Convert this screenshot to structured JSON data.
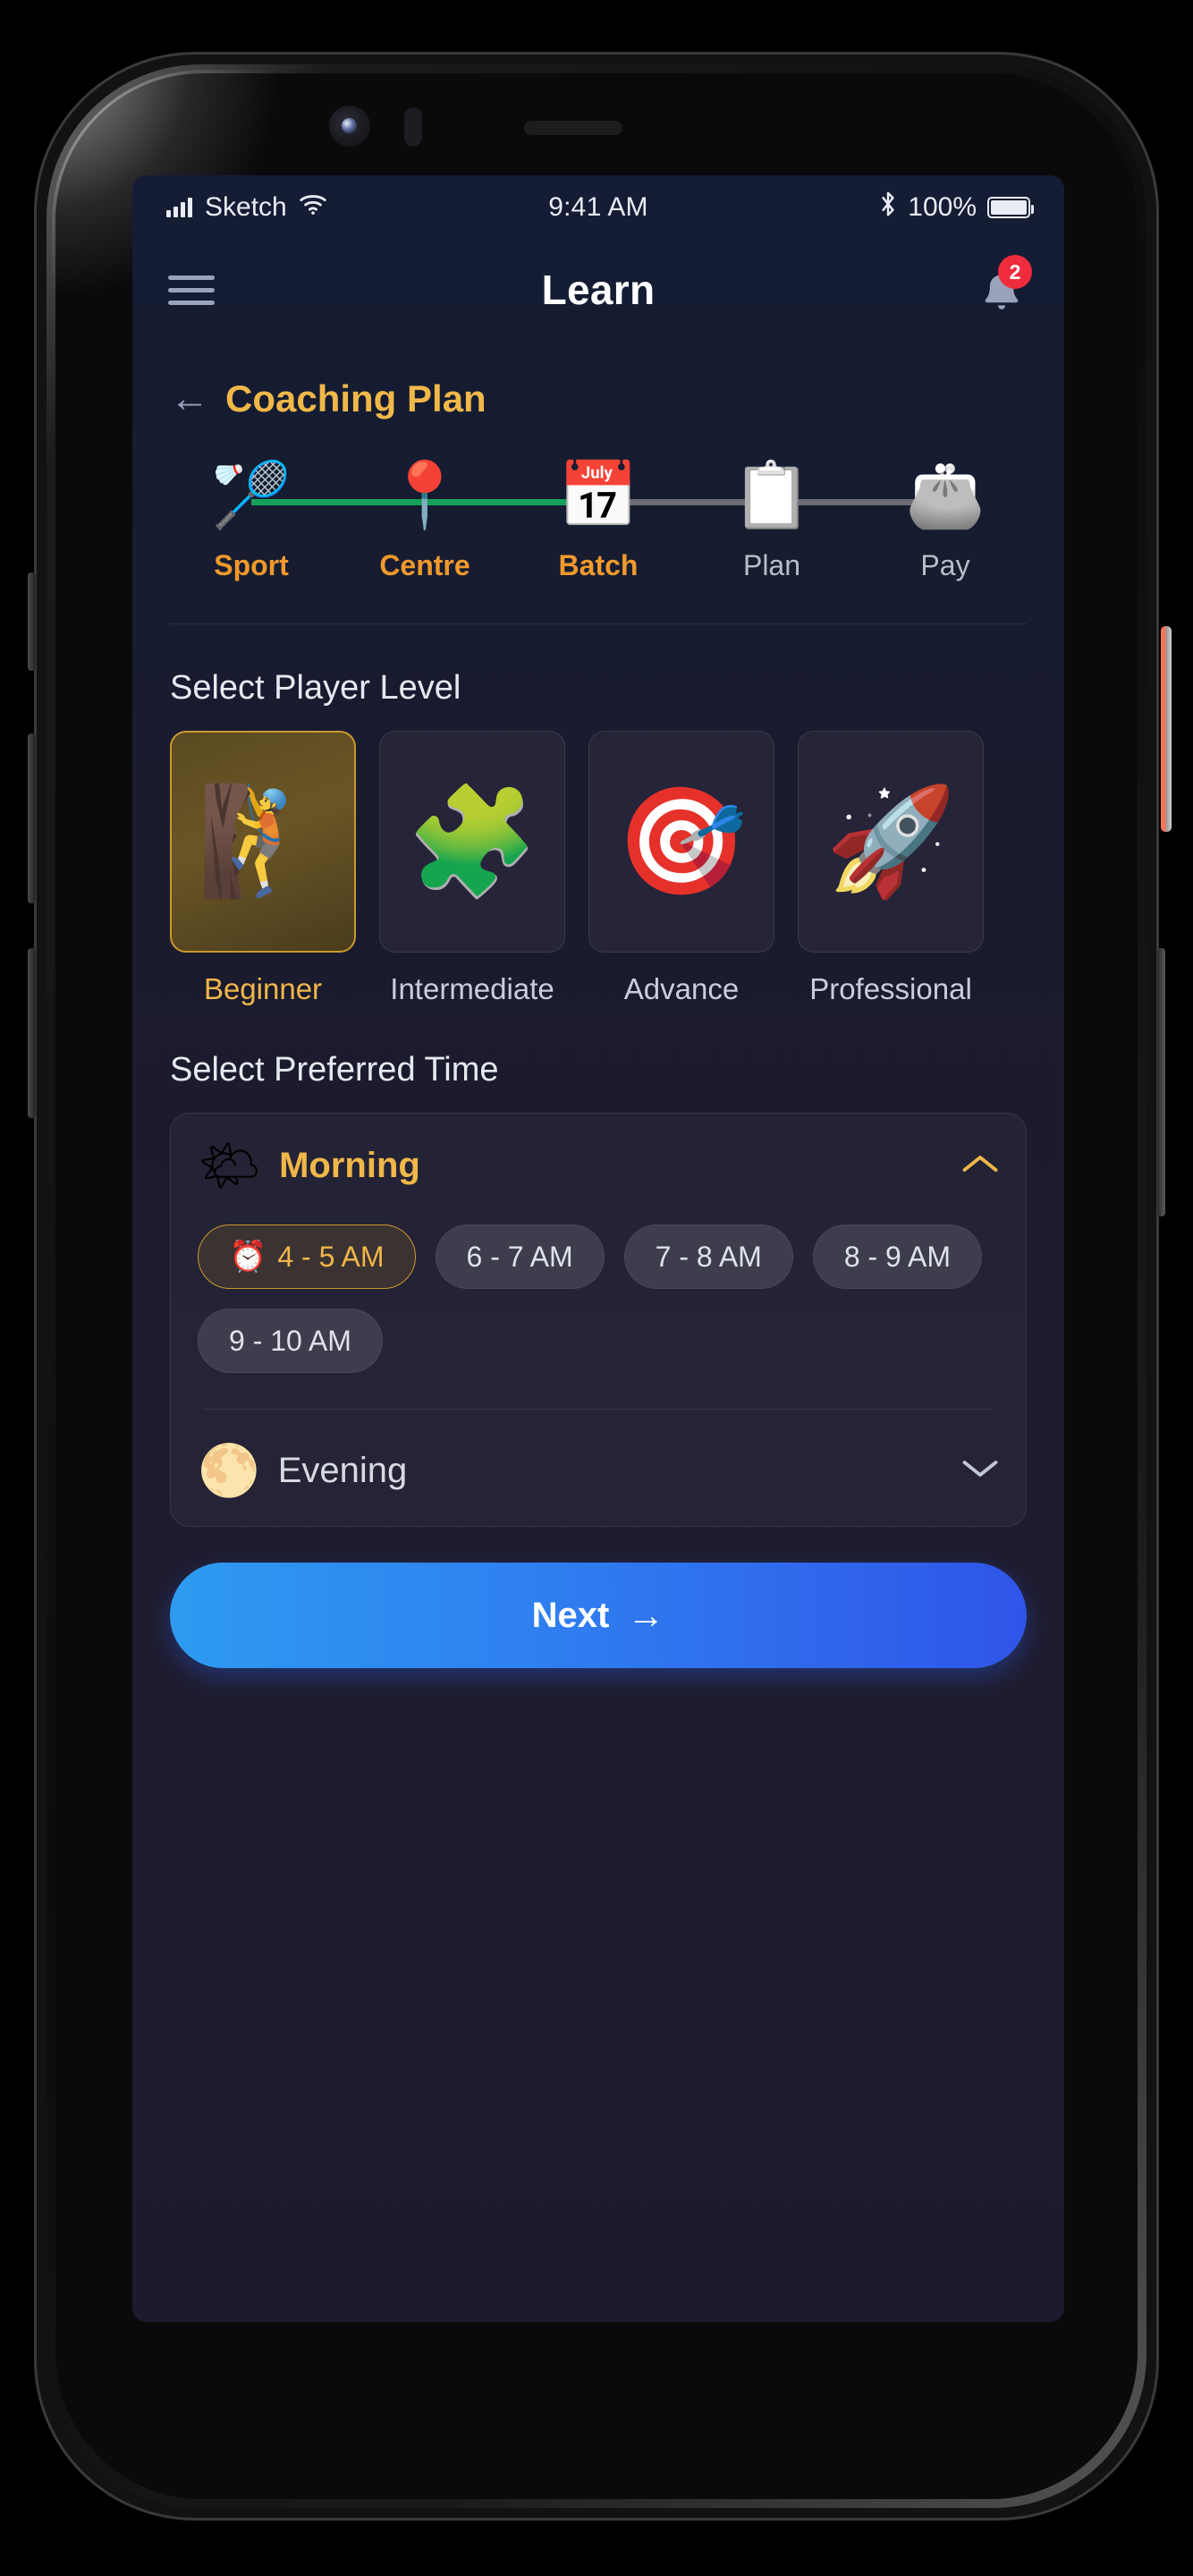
{
  "status_bar": {
    "carrier": "Sketch",
    "wifi_icon": "wifi-icon",
    "time": "9:41 AM",
    "bluetooth_icon": "bluetooth-icon",
    "battery_percent": "100%"
  },
  "app_bar": {
    "menu_icon": "hamburger-menu-icon",
    "title": "Learn",
    "bell_icon": "notification-bell-icon",
    "notification_count": "2"
  },
  "page": {
    "back_arrow": "←",
    "title": "Coaching Plan"
  },
  "stepper": {
    "steps": [
      {
        "label": "Sport",
        "icon": "🏸",
        "state": "done"
      },
      {
        "label": "Centre",
        "icon": "📍",
        "state": "done"
      },
      {
        "label": "Batch",
        "icon": "📅",
        "state": "done"
      },
      {
        "label": "Plan",
        "icon": "📋",
        "state": "todo"
      },
      {
        "label": "Pay",
        "icon": "👛",
        "state": "todo"
      }
    ]
  },
  "player_level": {
    "title": "Select Player Level",
    "options": [
      {
        "label": "Beginner",
        "icon": "🧗",
        "selected": true
      },
      {
        "label": "Intermediate",
        "icon": "🧩",
        "selected": false
      },
      {
        "label": "Advance",
        "icon": "🎯",
        "selected": false
      },
      {
        "label": "Professional",
        "icon": "🚀",
        "selected": false
      }
    ]
  },
  "preferred_time": {
    "title": "Select Preferred Time",
    "morning": {
      "label": "Morning",
      "icon": "🌤",
      "expanded": true,
      "chevron": "chevron-up-icon",
      "slots": [
        {
          "label": "4 - 5 AM",
          "icon": "⏰",
          "selected": true
        },
        {
          "label": "6 - 7 AM",
          "icon": "",
          "selected": false
        },
        {
          "label": "7 - 8 AM",
          "icon": "",
          "selected": false
        },
        {
          "label": "8 - 9 AM",
          "icon": "",
          "selected": false
        },
        {
          "label": "9 - 10 AM",
          "icon": "",
          "selected": false
        }
      ]
    },
    "evening": {
      "label": "Evening",
      "icon": "🌕",
      "expanded": false,
      "chevron": "chevron-down-icon"
    }
  },
  "footer": {
    "next_label": "Next",
    "next_arrow": "→"
  },
  "colors": {
    "accent_amber": "#f0b749",
    "accent_orange": "#f0992c",
    "progress_done": "#15a05a",
    "progress_todo": "#6b6b72",
    "badge_red": "#ef2c3e",
    "cta_blue_start": "#2e9bf0",
    "cta_blue_end": "#2f55e8",
    "screen_bg_top": "#141d35",
    "screen_bg_bottom": "#1c1a2c"
  }
}
